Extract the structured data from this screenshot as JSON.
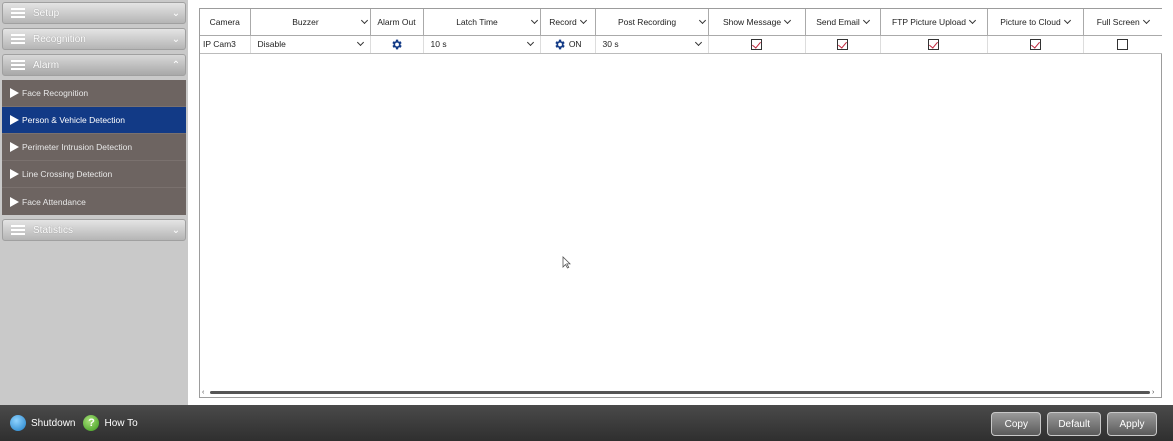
{
  "sidebar": {
    "sections": [
      {
        "label": "Setup",
        "state": "collapsed"
      },
      {
        "label": "Recognition",
        "state": "collapsed"
      },
      {
        "label": "Alarm",
        "state": "expanded"
      },
      {
        "label": "Statistics",
        "state": "collapsed"
      }
    ],
    "alarm_items": [
      {
        "label": "Face Recognition",
        "active": false
      },
      {
        "label": "Person & Vehicle Detection",
        "active": true
      },
      {
        "label": "Perimeter Intrusion Detection",
        "active": false
      },
      {
        "label": "Line Crossing Detection",
        "active": false
      },
      {
        "label": "Face Attendance",
        "active": false
      }
    ]
  },
  "table": {
    "headers": {
      "camera": "Camera",
      "buzzer": "Buzzer",
      "alarm_out": "Alarm Out",
      "latch_time": "Latch Time",
      "record": "Record",
      "post_recording": "Post Recording",
      "show_message": "Show Message",
      "send_email": "Send Email",
      "ftp_upload": "FTP Picture Upload",
      "picture_cloud": "Picture to Cloud",
      "full_screen": "Full Screen"
    },
    "rows": [
      {
        "camera": "IP Cam3",
        "buzzer": "Disable",
        "latch_time": "10 s",
        "record": "ON",
        "post_recording": "30 s",
        "show_message": true,
        "send_email": true,
        "ftp_upload": true,
        "picture_cloud": true,
        "full_screen": false
      }
    ]
  },
  "bottombar": {
    "shutdown_label": "Shutdown",
    "howto_label": "How To",
    "howto_glyph": "?",
    "copy_label": "Copy",
    "default_label": "Default",
    "apply_label": "Apply"
  },
  "colors": {
    "active_item": "#123a86",
    "submenu_bg": "#6d6461",
    "gear": "#123a86",
    "check_mark": "#c0243a"
  }
}
